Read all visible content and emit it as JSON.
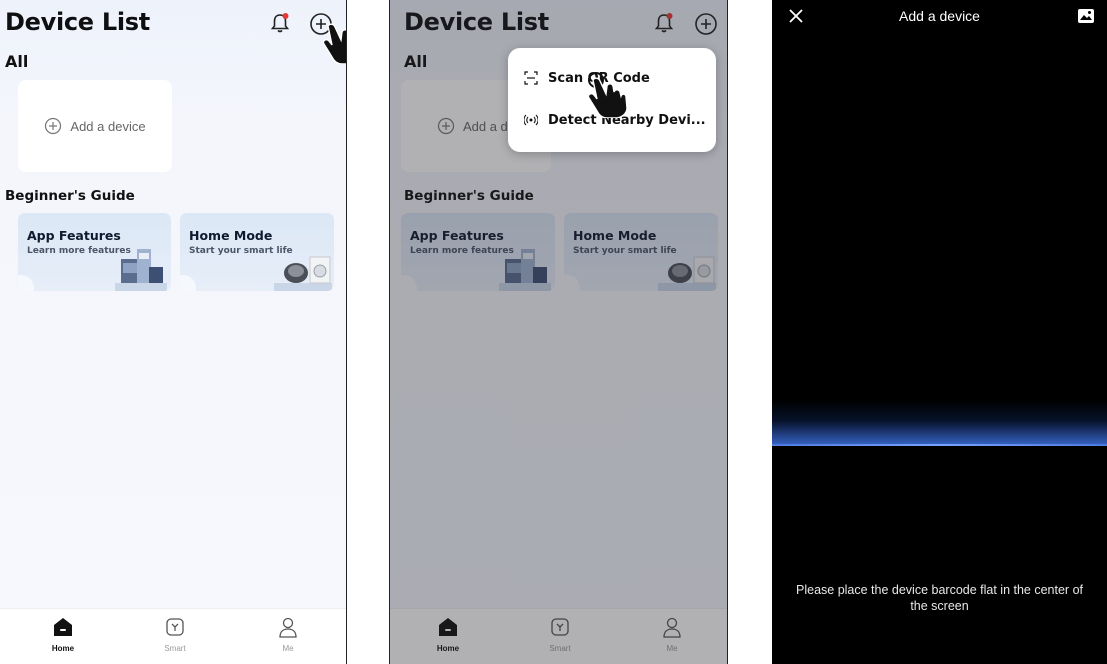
{
  "screen1": {
    "title": "Device List",
    "section_all": "All",
    "add_device_label": "Add a device",
    "guide_heading": "Beginner's Guide",
    "cards": [
      {
        "title": "App Features",
        "subtitle": "Learn more features"
      },
      {
        "title": "Home Mode",
        "subtitle": "Start your smart life"
      }
    ],
    "tabs": [
      {
        "label": "Home",
        "icon": "home-icon"
      },
      {
        "label": "Smart",
        "icon": "smart-icon"
      },
      {
        "label": "Me",
        "icon": "person-icon"
      }
    ]
  },
  "screen2": {
    "title": "Device List",
    "section_all": "All",
    "add_device_label": "Add a de",
    "guide_heading": "Beginner's Guide",
    "cards": [
      {
        "title": "App Features",
        "subtitle": "Learn more features"
      },
      {
        "title": "Home Mode",
        "subtitle": "Start your smart life"
      }
    ],
    "menu": [
      {
        "label": "Scan QR Code",
        "icon": "scan-icon"
      },
      {
        "label": "Detect Nearby Devi...",
        "icon": "radar-icon"
      }
    ],
    "tabs": [
      {
        "label": "Home",
        "icon": "home-icon"
      },
      {
        "label": "Smart",
        "icon": "smart-icon"
      },
      {
        "label": "Me",
        "icon": "person-icon"
      }
    ]
  },
  "screen3": {
    "title": "Add a device",
    "hint": "Please place the device barcode flat in the center of the screen"
  },
  "colors": {
    "accent_notification": "#e53935",
    "scan_beam": "#5b86e5",
    "background_light": "#f4f6fc"
  }
}
